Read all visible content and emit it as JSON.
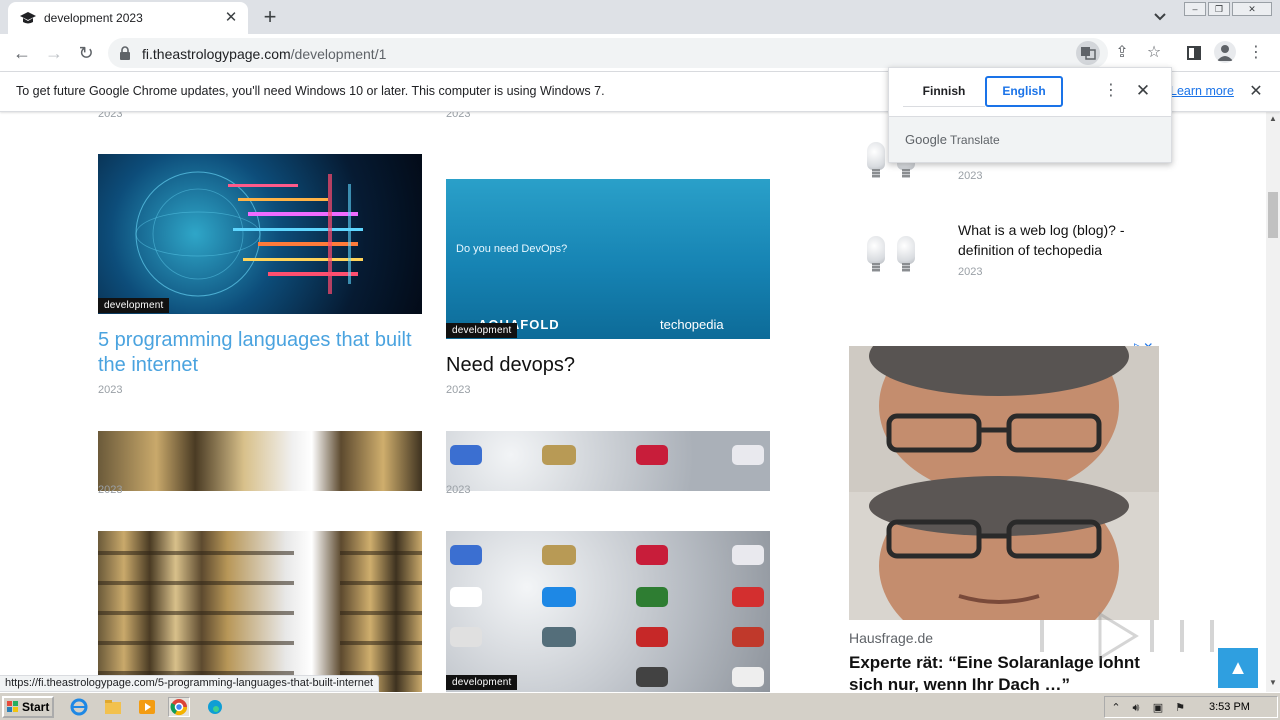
{
  "browser": {
    "tab_title": "development 2023",
    "url_host": "fi.theastrologypage.com",
    "url_path": "/development/1",
    "link_hover_url": "https://fi.theastrologypage.com/5-programming-languages-that-built-internet"
  },
  "infobar": {
    "message": "To get future Google Chrome updates, you'll need Windows 10 or later. This computer is using Windows 7.",
    "learn_more": "Learn more"
  },
  "translate_popup": {
    "source_language": "Finnish",
    "target_language": "English",
    "brand_google": "Google",
    "brand_translate": "Translate"
  },
  "posts": {
    "top_year_left": "2023",
    "top_year_right": "2023",
    "card1": {
      "category": "development",
      "title": "5 programming languages that built the internet",
      "year": "2023"
    },
    "card2": {
      "category": "development",
      "title": "Need devops?",
      "year": "2023",
      "image_caption": "Do you need DevOps?",
      "image_brand_left": "AQUAFOLD",
      "image_brand_right": "techopedia"
    },
    "card3": {
      "year": "2023"
    },
    "card4": {
      "year": "2023"
    },
    "card6": {
      "category": "development"
    }
  },
  "sidebar": {
    "item1": {
      "year": "2023"
    },
    "item2": {
      "title": "What is a web log (blog)? - definition of techopedia",
      "year": "2023"
    }
  },
  "ad": {
    "source": "Hausfrage.de",
    "headline": "Experte rät: “Eine Solaranlage lohnt sich nur, wenn Ihr Dach …”"
  },
  "taskbar": {
    "start_label": "Start",
    "clock": "3:53 PM"
  },
  "colors": {
    "link_blue": "#4aa3df",
    "chrome_blue": "#1a73e8",
    "back_to_top": "#2f9fe0"
  }
}
